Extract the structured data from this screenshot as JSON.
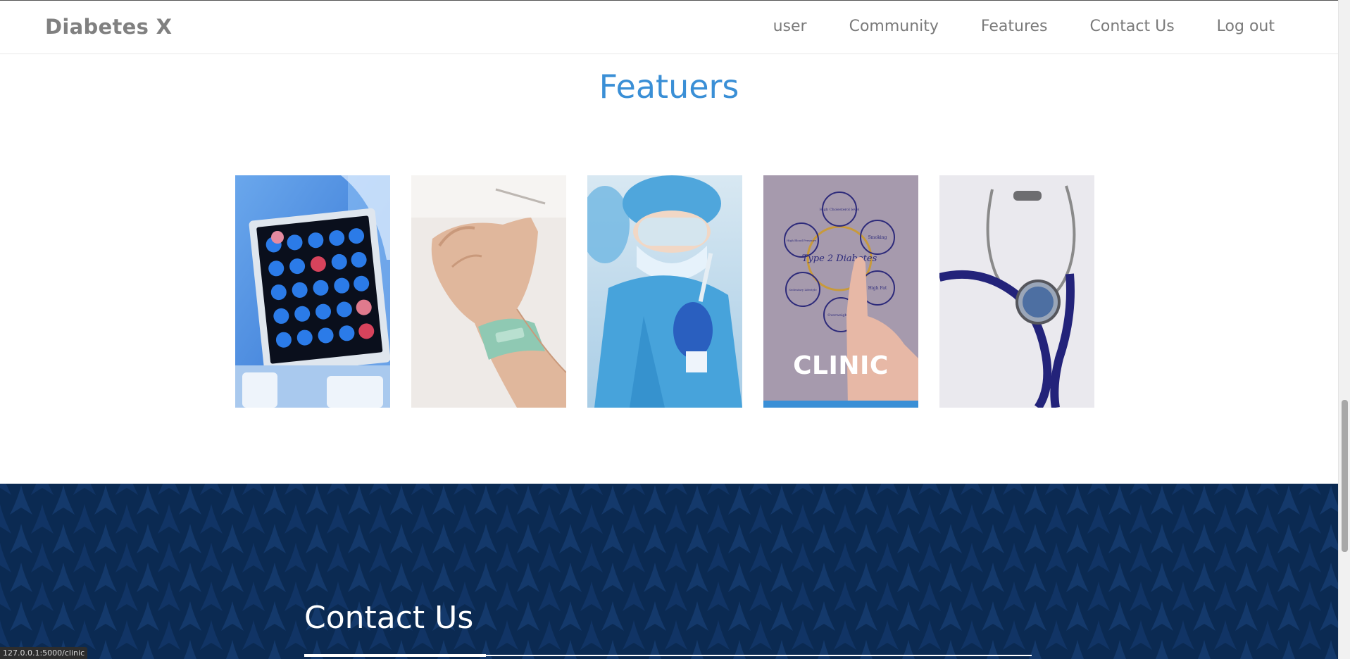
{
  "nav": {
    "brand": "Diabetes X",
    "links": [
      "user",
      "Community",
      "Features",
      "Contact Us",
      "Log out"
    ]
  },
  "features": {
    "title": "Featuers",
    "cards": [
      {
        "label": ""
      },
      {
        "label": ""
      },
      {
        "label": ""
      },
      {
        "label": "CLINIC",
        "diagram_center": "Type 2 Diabetes",
        "diagram_items": [
          "High Cholesterol level",
          "Smoking",
          "High Fat",
          "Overweighting",
          "Sedentary Lifestyle",
          "High Blood Pressure"
        ]
      },
      {
        "label": ""
      }
    ]
  },
  "contact": {
    "title": "Contact Us"
  },
  "status_bar": {
    "url": "127.0.0.1:5000/clinic"
  },
  "colors": {
    "accent": "#3a8fd6",
    "nav_text": "#7a7a7a",
    "footer_bg": "#0b2a52"
  }
}
